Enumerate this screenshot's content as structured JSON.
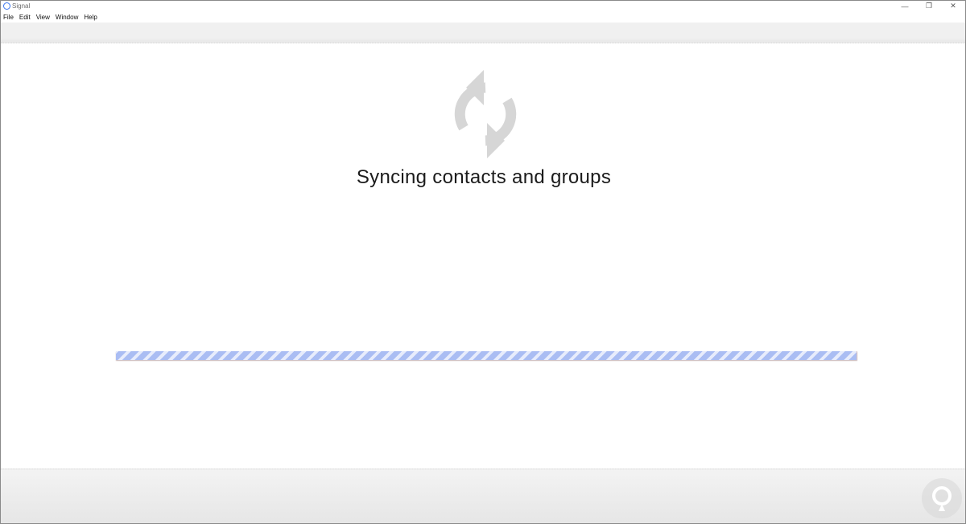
{
  "window": {
    "title": "Signal",
    "controls": {
      "minimize": "—",
      "restore": "❐",
      "close": "✕"
    }
  },
  "menu": {
    "items": [
      "File",
      "Edit",
      "View",
      "Window",
      "Help"
    ]
  },
  "sync": {
    "icon": "sync-icon",
    "message": "Syncing contacts and groups"
  },
  "progress": {
    "state": "indeterminate"
  },
  "colors": {
    "accent": "#3a76f0",
    "progress_stripe": "#aabdf3",
    "icon_gray": "#d6d6d6"
  }
}
